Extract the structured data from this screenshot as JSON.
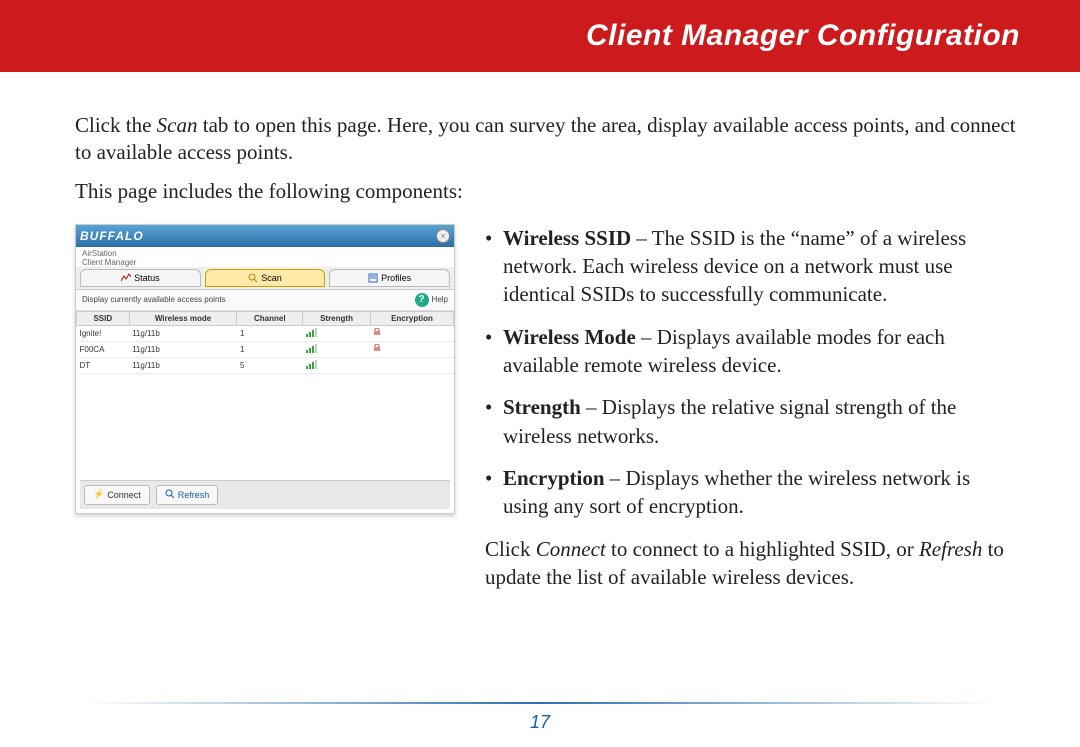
{
  "header": {
    "title": "Client Manager Configuration"
  },
  "intro": {
    "pre": "Click the ",
    "scan": "Scan",
    "post": " tab to open this page. Here, you can survey the area, display available access points, and connect to available access points."
  },
  "sub_intro": "This page includes the following components:",
  "screenshot": {
    "brand": "BUFFALO",
    "close_glyph": "×",
    "subtitle_1": "AirStation",
    "subtitle_2": "Client Manager",
    "tabs": {
      "status": "Status",
      "scan": "Scan",
      "profiles": "Profiles"
    },
    "caption": "Display currently available access points",
    "help_label": "Help",
    "columns": {
      "ssid": "SSID",
      "mode": "Wireless mode",
      "channel": "Channel",
      "strength": "Strength",
      "encryption": "Encryption"
    },
    "rows": [
      {
        "ssid": "Ignite!",
        "mode": "11g/11b",
        "channel": "1",
        "enc": true
      },
      {
        "ssid": "F00CA",
        "mode": "11g/11b",
        "channel": "1",
        "enc": true
      },
      {
        "ssid": "DT",
        "mode": "11g/11b",
        "channel": "5",
        "enc": false
      }
    ],
    "buttons": {
      "connect": "Connect",
      "refresh": "Refresh"
    }
  },
  "bullets": {
    "ssid_term": "Wireless SSID",
    "ssid_text": " – The SSID is the “name” of a wireless network. Each wireless device on a network must use identical SSIDs to successfully communicate.",
    "mode_term": "Wireless Mode",
    "mode_text": " – Displays available modes for each available remote wireless device.",
    "strength_term": "Strength",
    "strength_text": " – Displays the relative signal strength of the wireless networks.",
    "enc_term": "Encryption",
    "enc_text": " – Displays whether the wireless network is using any sort of encryption."
  },
  "closing": {
    "pre": "Click ",
    "connect": "Connect",
    "mid": " to connect to a highlighted SSID, or ",
    "refresh": "Refresh",
    "post": " to update the list of available wireless devices."
  },
  "page_number": "17"
}
